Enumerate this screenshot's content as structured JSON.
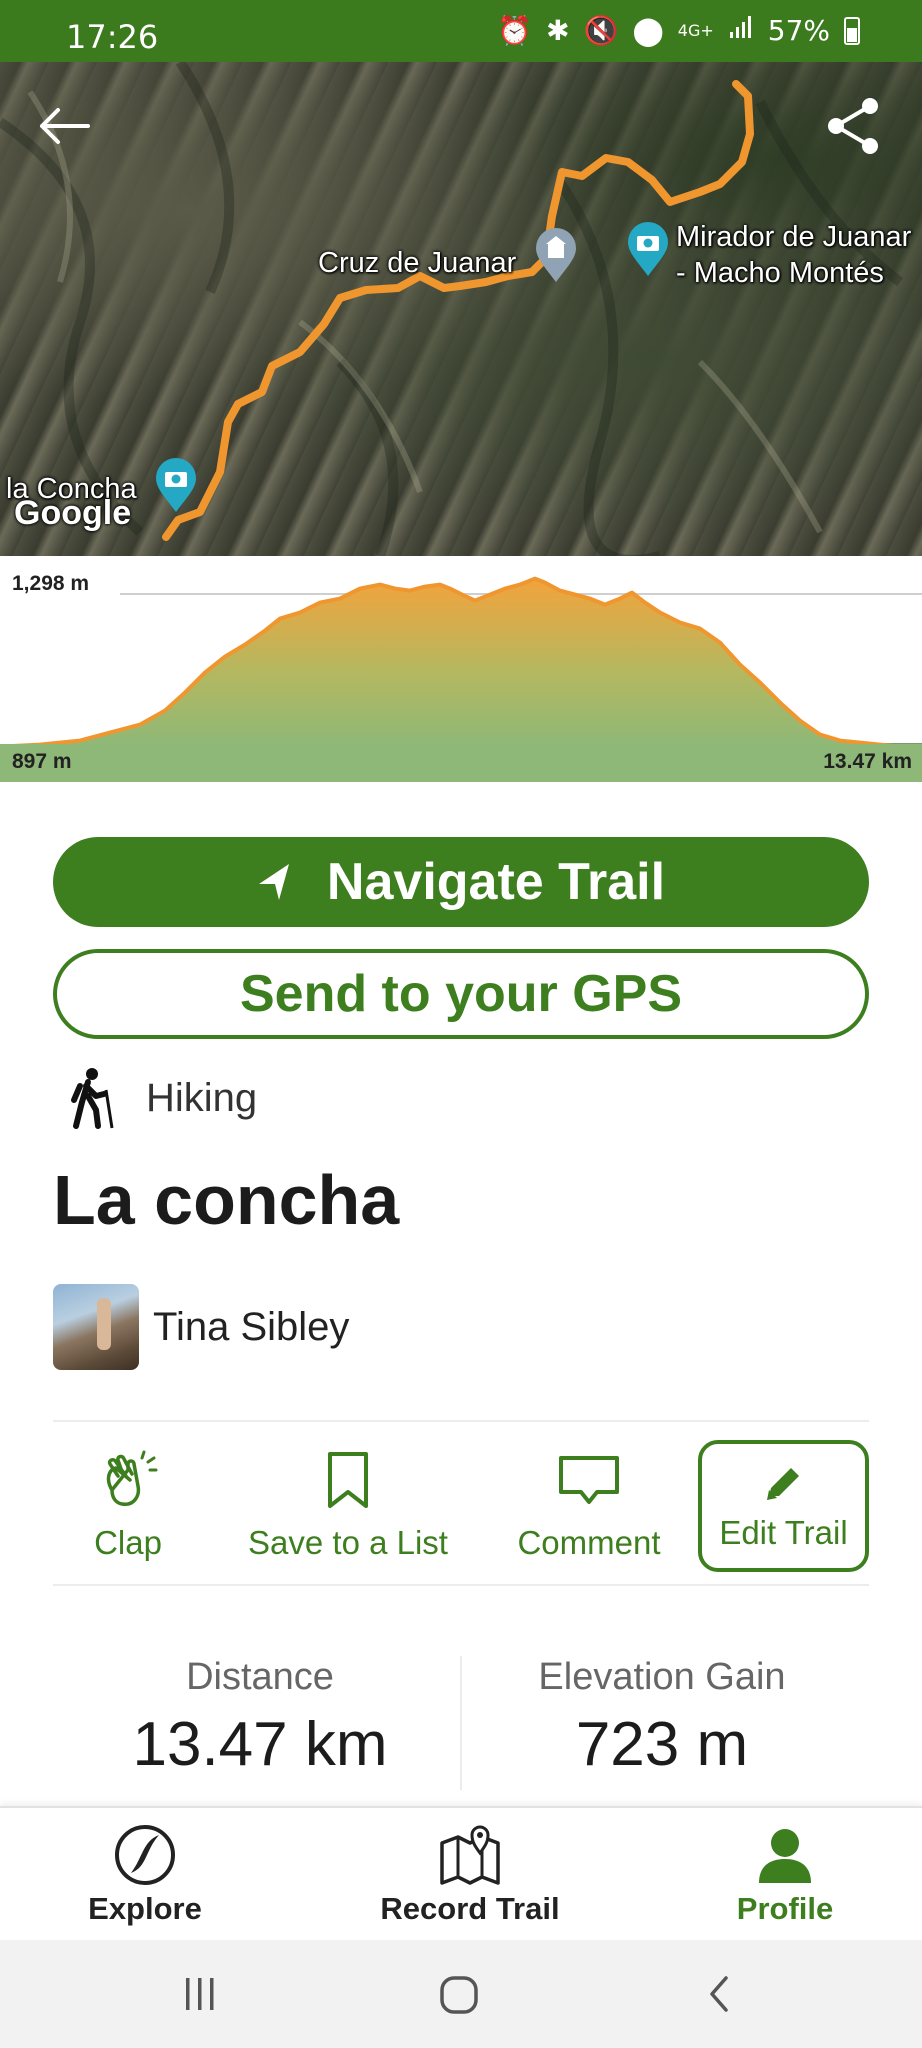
{
  "status_bar": {
    "time": "17:26",
    "network": "4G+",
    "battery": "57%",
    "icons": [
      "alarm-icon",
      "bluetooth-icon",
      "mute-icon",
      "location-icon",
      "signal-icon",
      "battery-icon"
    ]
  },
  "map": {
    "labels": {
      "cruz": "Cruz de Juanar",
      "mirador_line1": "Mirador de Juanar",
      "mirador_line2": "- Macho Montés",
      "concha": "la Concha"
    },
    "attribution": "Google",
    "route_color": "#f0962e"
  },
  "elevation": {
    "max_label": "1,298 m",
    "min_label": "897 m",
    "distance_label": "13.47 km",
    "max_m": 1298,
    "min_m": 897,
    "distance_km": 13.47
  },
  "buttons": {
    "navigate": "Navigate Trail",
    "send_gps": "Send to your GPS"
  },
  "trail": {
    "activity": "Hiking",
    "title": "La concha",
    "author": "Tina Sibley"
  },
  "actions": {
    "clap": "Clap",
    "save": "Save to a List",
    "comment": "Comment",
    "edit": "Edit Trail"
  },
  "stats": {
    "distance_label": "Distance",
    "distance_value": "13.47 km",
    "elevation_label": "Elevation Gain",
    "elevation_value": "723 m"
  },
  "bottom_nav": {
    "explore": "Explore",
    "record": "Record Trail",
    "profile": "Profile",
    "active": "profile"
  },
  "colors": {
    "brand_green": "#3d7e1f",
    "status_bar": "#3c7a1e",
    "pin_teal": "#25a8c4"
  }
}
